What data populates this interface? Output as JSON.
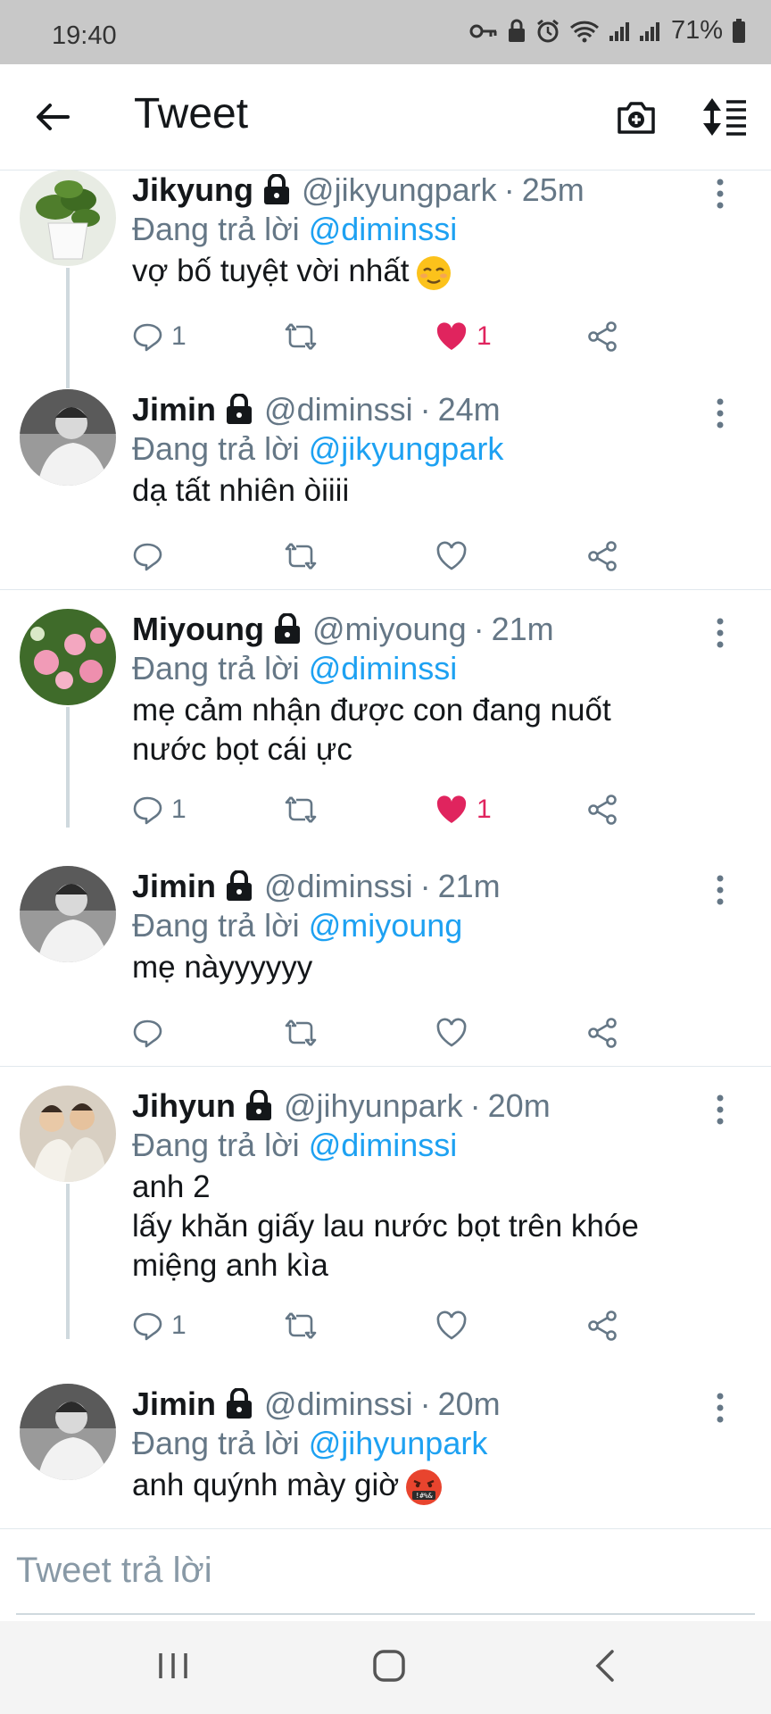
{
  "status_bar": {
    "time": "19:40",
    "battery_percent": "71%",
    "icons": [
      "key-icon",
      "lock-notification-icon",
      "alarm-icon",
      "wifi-icon",
      "signal-icon",
      "signal-icon",
      "battery-icon"
    ]
  },
  "header": {
    "title": "Tweet",
    "back_icon": "back-arrow-icon",
    "camera_icon": "camera-add-icon",
    "sort_icon": "sort-icon"
  },
  "colors": {
    "accent": "#1da1f2",
    "like": "#e0245e",
    "muted": "#657786"
  },
  "tweets": [
    {
      "name": "Jikyung",
      "handle": "@jikyungpark",
      "time": "25m",
      "reply_label": "Đang trả lời",
      "reply_to": "@diminssi",
      "lines": [
        "vợ bố tuyệt vời nhất"
      ],
      "emoji": "relieved-face",
      "reply_count": "1",
      "like_count": "1",
      "liked": true
    },
    {
      "name": "Jimin",
      "handle": "@diminssi",
      "time": "24m",
      "reply_label": "Đang trả lời",
      "reply_to": "@jikyungpark",
      "lines": [
        "dạ tất nhiên òiiii"
      ],
      "reply_count": "",
      "like_count": "",
      "liked": false
    },
    {
      "name": "Miyoung",
      "handle": "@miyoung",
      "time": "21m",
      "reply_label": "Đang trả lời",
      "reply_to": "@diminssi",
      "lines": [
        "mẹ cảm nhận được con đang nuốt",
        "nước bọt cái ực"
      ],
      "reply_count": "1",
      "like_count": "1",
      "liked": true
    },
    {
      "name": "Jimin",
      "handle": "@diminssi",
      "time": "21m",
      "reply_label": "Đang trả lời",
      "reply_to": "@miyoung",
      "lines": [
        "mẹ nàyyyyyy"
      ],
      "reply_count": "",
      "like_count": "",
      "liked": false
    },
    {
      "name": "Jihyun",
      "handle": "@jihyunpark",
      "time": "20m",
      "reply_label": "Đang trả lời",
      "reply_to": "@diminssi",
      "lines": [
        "anh 2",
        "lấy khăn giấy lau nước bọt trên khóe",
        "miệng anh kìa"
      ],
      "reply_count": "1",
      "like_count": "",
      "liked": false
    },
    {
      "name": "Jimin",
      "handle": "@diminssi",
      "time": "20m",
      "reply_label": "Đang trả lời",
      "reply_to": "@jihyunpark",
      "lines": [
        "anh quýnh mày giờ"
      ],
      "emoji": "face-with-symbols-on-mouth"
    }
  ],
  "reply_bar": {
    "placeholder": "Tweet trả lời"
  },
  "nav_bar": {
    "icons": [
      "recent-apps-icon",
      "home-icon",
      "back-icon"
    ]
  }
}
